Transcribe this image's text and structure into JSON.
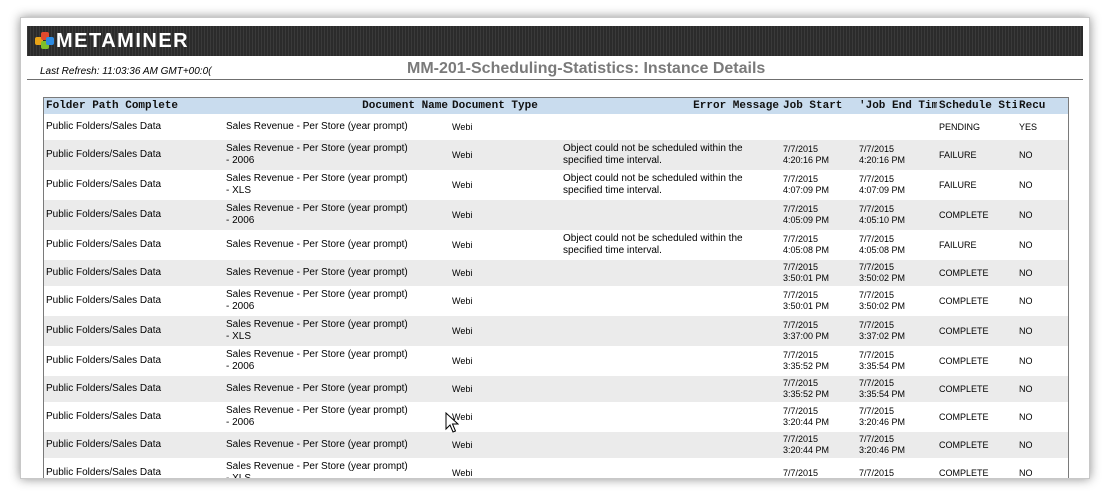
{
  "brand": {
    "name": "METAMINER",
    "colors": {
      "banner": "#2b2b2b",
      "header_fill": "#c9dcee",
      "alt_row": "#ebebeb",
      "title_gray": "#7a7a7a"
    }
  },
  "report": {
    "last_refresh": "Last Refresh: 11:03:36 AM GMT+00:0(",
    "title": "MM-201-Scheduling-Statistics: Instance Details"
  },
  "table": {
    "columns": [
      "Folder Path Complete",
      "Document Name",
      "Document Type",
      "Error Message",
      "Job Start",
      "'Job End Tim",
      "Schedule Stis",
      "Recu"
    ],
    "rows": [
      {
        "folder": "Public Folders/Sales Data",
        "name1": "Sales Revenue - Per Store (year prompt)",
        "name2": "",
        "type": "Webi",
        "error1": "",
        "error2": "",
        "start_date": "",
        "start_time": "",
        "end_date": "",
        "end_time": "",
        "status": "PENDING",
        "recurring": "YES"
      },
      {
        "folder": "Public Folders/Sales Data",
        "name1": "Sales Revenue - Per Store (year prompt)",
        "name2": "- 2006",
        "type": "Webi",
        "error1": "Object could not be scheduled within the",
        "error2": "specified time interval.",
        "start_date": "7/7/2015",
        "start_time": "4:20:16 PM",
        "end_date": "7/7/2015",
        "end_time": "4:20:16 PM",
        "status": "FAILURE",
        "recurring": "NO"
      },
      {
        "folder": "Public Folders/Sales Data",
        "name1": "Sales Revenue - Per Store (year prompt)",
        "name2": "- XLS",
        "type": "Webi",
        "error1": "Object could not be scheduled within the",
        "error2": "specified time interval.",
        "start_date": "7/7/2015",
        "start_time": "4:07:09 PM",
        "end_date": "7/7/2015",
        "end_time": "4:07:09 PM",
        "status": "FAILURE",
        "recurring": "NO"
      },
      {
        "folder": "Public Folders/Sales Data",
        "name1": "Sales Revenue - Per Store (year prompt)",
        "name2": "- 2006",
        "type": "Webi",
        "error1": "",
        "error2": "",
        "start_date": "7/7/2015",
        "start_time": "4:05:09 PM",
        "end_date": "7/7/2015",
        "end_time": "4:05:10 PM",
        "status": "COMPLETE",
        "recurring": "NO"
      },
      {
        "folder": "Public Folders/Sales Data",
        "name1": "Sales Revenue - Per Store (year prompt)",
        "name2": "",
        "type": "Webi",
        "error1": "Object could not be scheduled within the",
        "error2": "specified time interval.",
        "start_date": "7/7/2015",
        "start_time": "4:05:08 PM",
        "end_date": "7/7/2015",
        "end_time": "4:05:08 PM",
        "status": "FAILURE",
        "recurring": "NO"
      },
      {
        "folder": "Public Folders/Sales Data",
        "name1": "Sales Revenue - Per Store (year prompt)",
        "name2": "",
        "type": "Webi",
        "error1": "",
        "error2": "",
        "start_date": "7/7/2015",
        "start_time": "3:50:01 PM",
        "end_date": "7/7/2015",
        "end_time": "3:50:02 PM",
        "status": "COMPLETE",
        "recurring": "NO"
      },
      {
        "folder": "Public Folders/Sales Data",
        "name1": "Sales Revenue - Per Store (year prompt)",
        "name2": "- 2006",
        "type": "Webi",
        "error1": "",
        "error2": "",
        "start_date": "7/7/2015",
        "start_time": "3:50:01 PM",
        "end_date": "7/7/2015",
        "end_time": "3:50:02 PM",
        "status": "COMPLETE",
        "recurring": "NO"
      },
      {
        "folder": "Public Folders/Sales Data",
        "name1": "Sales Revenue - Per Store (year prompt)",
        "name2": "- XLS",
        "type": "Webi",
        "error1": "",
        "error2": "",
        "start_date": "7/7/2015",
        "start_time": "3:37:00 PM",
        "end_date": "7/7/2015",
        "end_time": "3:37:02 PM",
        "status": "COMPLETE",
        "recurring": "NO"
      },
      {
        "folder": "Public Folders/Sales Data",
        "name1": "Sales Revenue - Per Store (year prompt)",
        "name2": "- 2006",
        "type": "Webi",
        "error1": "",
        "error2": "",
        "start_date": "7/7/2015",
        "start_time": "3:35:52 PM",
        "end_date": "7/7/2015",
        "end_time": "3:35:54 PM",
        "status": "COMPLETE",
        "recurring": "NO"
      },
      {
        "folder": "Public Folders/Sales Data",
        "name1": "Sales Revenue - Per Store (year prompt)",
        "name2": "",
        "type": "Webi",
        "error1": "",
        "error2": "",
        "start_date": "7/7/2015",
        "start_time": "3:35:52 PM",
        "end_date": "7/7/2015",
        "end_time": "3:35:54 PM",
        "status": "COMPLETE",
        "recurring": "NO"
      },
      {
        "folder": "Public Folders/Sales Data",
        "name1": "Sales Revenue - Per Store (year prompt)",
        "name2": "- 2006",
        "type": "Webi",
        "error1": "",
        "error2": "",
        "start_date": "7/7/2015",
        "start_time": "3:20:44 PM",
        "end_date": "7/7/2015",
        "end_time": "3:20:46 PM",
        "status": "COMPLETE",
        "recurring": "NO"
      },
      {
        "folder": "Public Folders/Sales Data",
        "name1": "Sales Revenue - Per Store (year prompt)",
        "name2": "",
        "type": "Webi",
        "error1": "",
        "error2": "",
        "start_date": "7/7/2015",
        "start_time": "3:20:44 PM",
        "end_date": "7/7/2015",
        "end_time": "3:20:46 PM",
        "status": "COMPLETE",
        "recurring": "NO"
      },
      {
        "folder": "Public Folders/Sales Data",
        "name1": "Sales Revenue - Per Store (year prompt)",
        "name2": "- XLS",
        "type": "Webi",
        "error1": "",
        "error2": "",
        "start_date": "7/7/2015",
        "start_time": "",
        "end_date": "7/7/2015",
        "end_time": "",
        "status": "COMPLETE",
        "recurring": "NO"
      }
    ]
  }
}
